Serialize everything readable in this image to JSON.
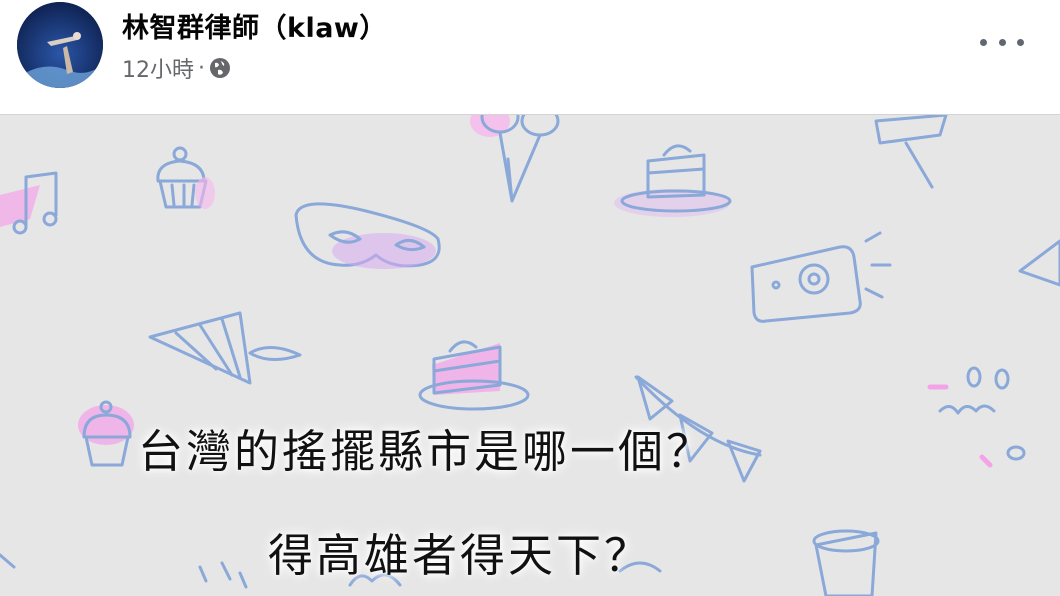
{
  "post": {
    "author": "林智群律師（klaw）",
    "time": "12小時",
    "dot": "·",
    "visibility_icon": "globe-icon",
    "more_icon": "more-horizontal-icon"
  },
  "image": {
    "line1": "台灣的搖擺縣市是哪一個？",
    "line2": "得高雄者得天下？",
    "background_color": "#e6e6e7",
    "accent_blue": "#8aa8d8",
    "accent_pink": "#f39be6"
  }
}
